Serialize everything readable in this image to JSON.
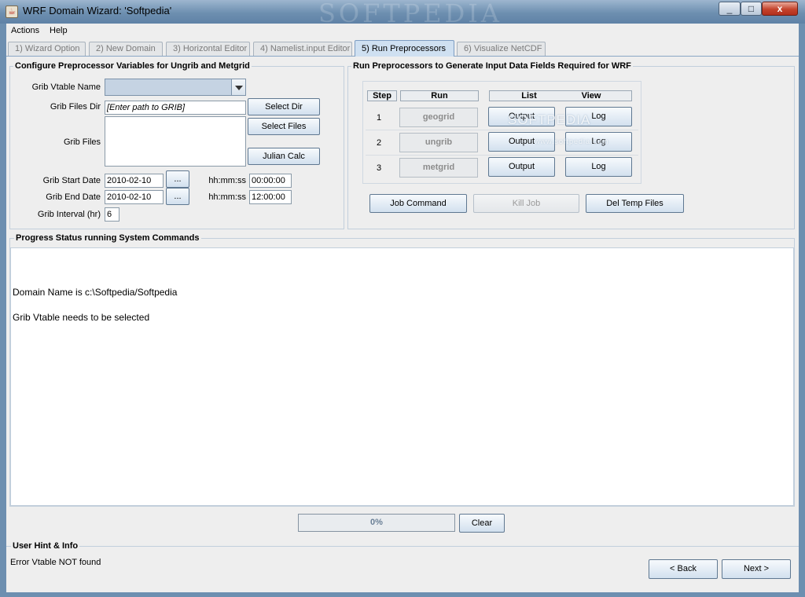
{
  "window": {
    "title": "WRF Domain Wizard: 'Softpedia'",
    "watermark": "SOFTPEDIA",
    "minimize": "_",
    "maximize": "□",
    "close": "x"
  },
  "menu": [
    "Actions",
    "Help"
  ],
  "tabs": [
    {
      "label": "1) Wizard Option",
      "active": false
    },
    {
      "label": "2) New Domain",
      "active": false
    },
    {
      "label": "3) Horizontal Editor",
      "active": false
    },
    {
      "label": "4) Namelist.input Editor",
      "active": false
    },
    {
      "label": "5) Run Preprocessors",
      "active": true
    },
    {
      "label": "6) Visualize NetCDF",
      "active": false
    }
  ],
  "config": {
    "title": "Configure Preprocessor Variables for Ungrib and Metgrid",
    "vtable_label": "Grib Vtable Name",
    "vtable_value": "",
    "files_dir_label": "Grib Files Dir",
    "files_dir_placeholder": "[Enter path to GRIB]",
    "select_dir": "Select Dir",
    "select_files": "Select Files",
    "grib_files_label": "Grib Files",
    "julian_calc": "Julian Calc",
    "start_date_label": "Grib Start Date",
    "start_date": "2010-02-10",
    "start_time_label": "hh:mm:ss",
    "start_time": "00:00:00",
    "end_date_label": "Grib End Date",
    "end_date": "2010-02-10",
    "end_time_label": "hh:mm:ss",
    "end_time": "12:00:00",
    "interval_label": "Grib Interval (hr)",
    "interval": "6",
    "picker_label": "..."
  },
  "run": {
    "title": "Run Preprocessors to Generate Input Data Fields Required for WRF",
    "headers": {
      "step": "Step",
      "run": "Run",
      "list": "List",
      "view": "View"
    },
    "rows": [
      {
        "step": "1",
        "run": "geogrid",
        "list": "Output",
        "view": "Log"
      },
      {
        "step": "2",
        "run": "ungrib",
        "list": "Output",
        "view": "Log"
      },
      {
        "step": "3",
        "run": "metgrid",
        "list": "Output",
        "view": "Log"
      }
    ],
    "watermark": "SOFTPEDIA",
    "watermark_small": "www.softpedia.com",
    "job_command": "Job Command",
    "kill_job": "Kill Job",
    "del_temp": "Del Temp Files"
  },
  "progress_panel": {
    "title": "Progress Status running System Commands",
    "lines": [
      "Domain Name is c:\\Softpedia/Softpedia",
      "Grib Vtable needs to be selected"
    ]
  },
  "progress": {
    "label": "0%",
    "value": 0
  },
  "clear": "Clear",
  "hint": {
    "title": "User Hint & Info",
    "text": "Error Vtable NOT found"
  },
  "nav": {
    "back": "<  Back",
    "next": "Next >"
  }
}
